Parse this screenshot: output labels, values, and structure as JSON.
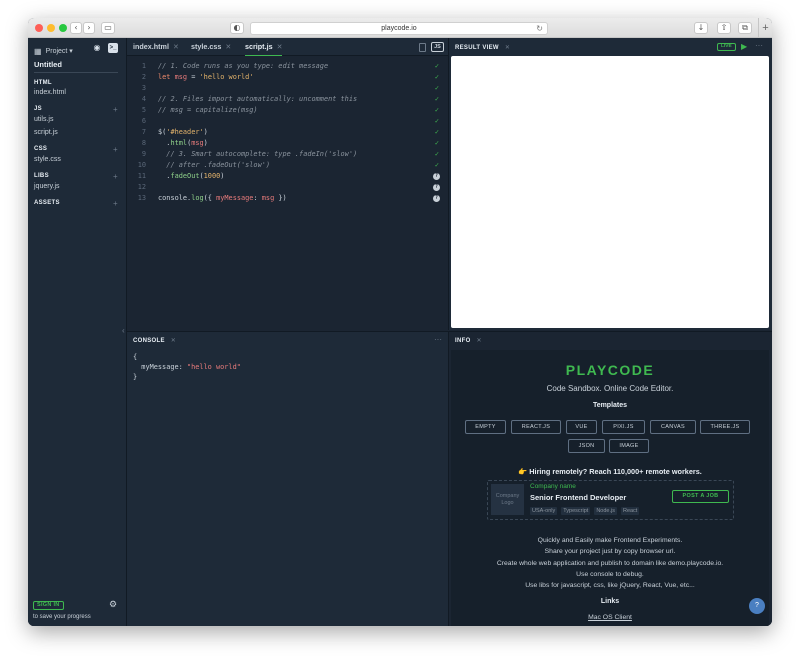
{
  "browser": {
    "url": "playcode.io",
    "colors": {
      "close": "#fe5f57",
      "minimize": "#febc2e",
      "zoom": "#28c840"
    }
  },
  "sidebar": {
    "project_label": "Project ▾",
    "title": "Untitled",
    "sections": [
      {
        "name": "HTML",
        "files": [
          "index.html"
        ]
      },
      {
        "name": "JS",
        "files": [
          "utils.js",
          "script.js"
        ]
      },
      {
        "name": "CSS",
        "files": [
          "style.css"
        ]
      },
      {
        "name": "LIBS",
        "files": [
          "jquery.js"
        ]
      },
      {
        "name": "ASSETS",
        "files": []
      }
    ],
    "sign_in": "SIGN IN",
    "save_note": "to save your progress"
  },
  "editor": {
    "tabs": [
      {
        "label": "index.html",
        "active": false
      },
      {
        "label": "style.css",
        "active": false
      },
      {
        "label": "script.js",
        "active": true
      }
    ],
    "lang_badge": "JS",
    "lines": [
      {
        "n": "1",
        "text": "// 1. Code runs as you type: edit message",
        "status": "ok"
      },
      {
        "n": "2",
        "text": "let msg = 'hello world'",
        "status": "ok"
      },
      {
        "n": "3",
        "text": "",
        "status": "ok"
      },
      {
        "n": "4",
        "text": "// 2. Files import automatically: uncomment this",
        "status": "ok"
      },
      {
        "n": "5",
        "text": "// msg = capitalize(msg)",
        "status": "ok"
      },
      {
        "n": "6",
        "text": "",
        "status": "ok"
      },
      {
        "n": "7",
        "text": "$('#header')",
        "status": "ok"
      },
      {
        "n": "8",
        "text": "  .html(msg)",
        "status": "ok"
      },
      {
        "n": "9",
        "text": "  // 3. Smart autocomplete: type .fadeIn('slow')",
        "status": "ok"
      },
      {
        "n": "10",
        "text": "  // after .fadeOut('slow')",
        "status": "ok"
      },
      {
        "n": "11",
        "text": "  .fadeOut(1000)",
        "status": "q"
      },
      {
        "n": "12",
        "text": "",
        "status": "q"
      },
      {
        "n": "13",
        "text": "console.log({ myMessage: msg })",
        "status": "q"
      }
    ]
  },
  "console": {
    "title": "CONSOLE",
    "output": [
      "{",
      "  myMessage: \"hello world\"",
      "}"
    ]
  },
  "result": {
    "title": "RESULT VIEW",
    "live_badge": "LIVE"
  },
  "info": {
    "title": "INFO",
    "brand": "PLAYCODE",
    "tagline": "Code Sandbox. Online Code Editor.",
    "templates_heading": "Templates",
    "templates_row1": [
      "EMPTY",
      "REACT.JS",
      "VUE",
      "PIXI.JS",
      "CANVAS",
      "THREE.JS"
    ],
    "templates_row2": [
      "JSON",
      "IMAGE"
    ],
    "hiring": "👉 Hiring remotely? Reach 110,000+ remote workers.",
    "job": {
      "logo": "Company Logo",
      "company": "Company name",
      "title": "Senior Frontend Developer",
      "tags": [
        "USA-only",
        "Typescript",
        "Node.js",
        "React"
      ],
      "post_button": "POST A JOB"
    },
    "lines": [
      "Quickly and Easily make Frontend Experiments.",
      "Share your project just by copy browser url.",
      "Create whole web application and publish to domain like demo.playcode.io.",
      "Use console to debug.",
      "Use libs for javascript, css, like jQuery, React, Vue, etc..."
    ],
    "links_heading": "Links",
    "mac_link": "Mac OS Client",
    "help": "?"
  }
}
